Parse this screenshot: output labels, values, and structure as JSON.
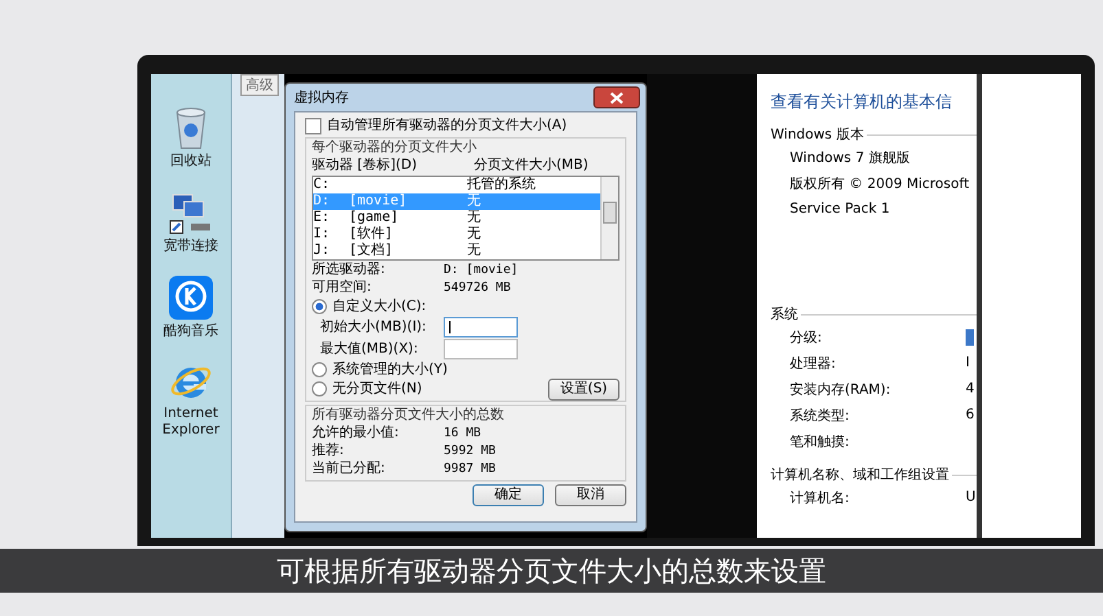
{
  "desktop_icons": [
    {
      "label": "回收站",
      "kind": "recycle"
    },
    {
      "label": "宽带连接",
      "kind": "network"
    },
    {
      "label": "酷狗音乐",
      "kind": "kugou"
    },
    {
      "label": "Internet Explorer",
      "kind": "ie"
    }
  ],
  "background_window": {
    "tab": "高级"
  },
  "dialog": {
    "title": "虚拟内存",
    "auto_manage": {
      "label": "自动管理所有驱动器的分页文件大小(A)",
      "checked": false
    },
    "group_title": "每个驱动器的分页文件大小",
    "columns": [
      "驱动器 [卷标](D)",
      "分页文件大小(MB)"
    ],
    "drives": [
      {
        "drive": "C:",
        "size": "托管的系统",
        "selected": false
      },
      {
        "drive": "D:",
        "label": "[movie]",
        "size": "无",
        "selected": true
      },
      {
        "drive": "E:",
        "label": "[game]",
        "size": "无",
        "selected": false
      },
      {
        "drive": "I:",
        "label": "[软件]",
        "size": "无",
        "selected": false
      },
      {
        "drive": "J:",
        "label": "[文档]",
        "size": "无",
        "selected": false
      }
    ],
    "info": [
      {
        "label": "所选驱动器:",
        "value": "D:  [movie]"
      },
      {
        "label": "可用空间:",
        "value": "549726 MB"
      }
    ],
    "size_options": [
      {
        "kind": "custom",
        "label": "自定义大小(C):",
        "selected": true
      },
      {
        "kind": "system",
        "label": "系统管理的大小(Y)",
        "selected": false
      },
      {
        "kind": "none",
        "label": "无分页文件(N)",
        "selected": false
      }
    ],
    "fields": [
      {
        "label": "初始大小(MB)(I):",
        "focused": true
      },
      {
        "label": "最大值(MB)(X):",
        "focused": false
      }
    ],
    "set_button": "设置(S)",
    "total_title": "所有驱动器分页文件大小的总数",
    "totals": [
      {
        "label": "允许的最小值:",
        "value": "16 MB"
      },
      {
        "label": "推荐:",
        "value": "5992 MB"
      },
      {
        "label": "当前已分配:",
        "value": "9987 MB"
      }
    ],
    "buttons": [
      "确定",
      "取消"
    ]
  },
  "system_panel": {
    "heading": "查看有关计算机的基本信",
    "sections": [
      {
        "title": "Windows 版本",
        "rows": [
          {
            "label": "Windows 7 旗舰版"
          },
          {
            "label": "版权所有 © 2009 Microsoft"
          },
          {
            "label": "Service Pack 1"
          }
        ]
      },
      {
        "title": "系统",
        "rows": [
          {
            "label": "分级:",
            "kind": "rating"
          },
          {
            "label": "处理器:",
            "value": "I"
          },
          {
            "label": "安装内存(RAM):",
            "value": "4"
          },
          {
            "label": "系统类型:",
            "value": "6"
          },
          {
            "label": "笔和触摸:"
          }
        ]
      },
      {
        "title": "计算机名称、域和工作组设置",
        "rows": [
          {
            "label": "计算机名:",
            "value": "U"
          }
        ]
      }
    ]
  },
  "subtitle": "可根据所有驱动器分页文件大小的总数来设置"
}
